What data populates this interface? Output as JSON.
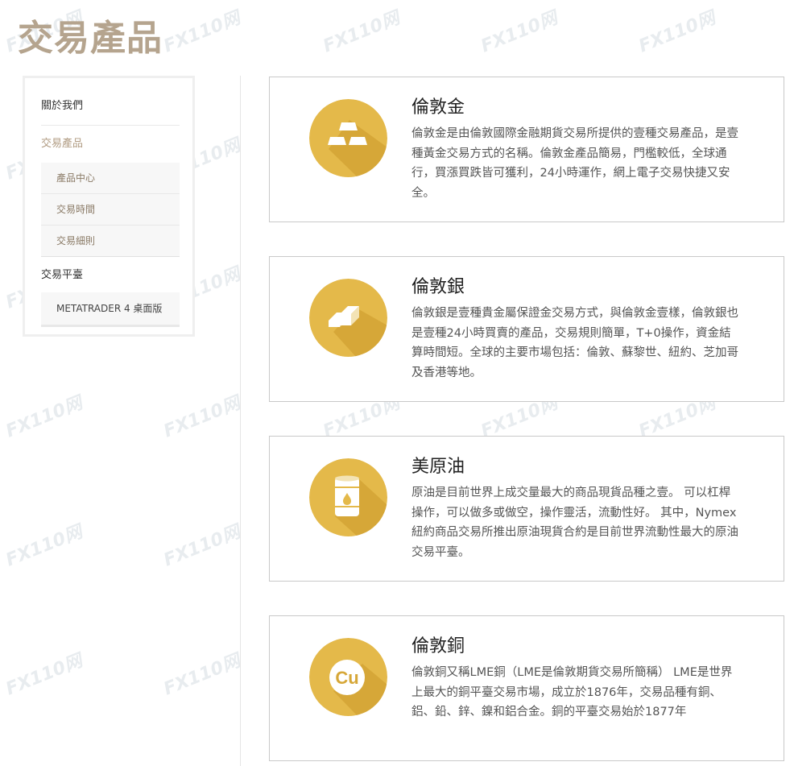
{
  "page": {
    "title": "交易產品",
    "title_color": "#b5a48e"
  },
  "sidebar": {
    "about": "關於我們",
    "products": {
      "label": "交易產品",
      "color": "#b09b82",
      "items": [
        "產品中心",
        "交易時間",
        "交易細則"
      ]
    },
    "platform": {
      "label": "交易平臺",
      "items": [
        "METATRADER 4 桌面版"
      ]
    }
  },
  "products": [
    {
      "name": "倫敦金",
      "icon": "gold-bars-icon",
      "desc": "倫敦金是由倫敦國際金融期貨交易所提供的壹種交易產品，是壹種黃金交易方式的名稱。倫敦金產品簡易，門檻較低，全球通行，買漲買跌皆可獲利，24小時運作，網上電子交易快捷又安全。"
    },
    {
      "name": "倫敦銀",
      "icon": "silver-bars-icon",
      "desc": "倫敦銀是壹種貴金屬保證金交易方式，與倫敦金壹樣，倫敦銀也是壹種24小時買賣的產品，交易規則簡單，T+0操作，資金結算時間短。全球的主要市場包括：倫敦、蘇黎世、紐約、芝加哥及香港等地。"
    },
    {
      "name": "美原油",
      "icon": "oil-barrel-icon",
      "desc": "原油是目前世界上成交量最大的商品現貨品種之壹。 可以杠桿操作，可以做多或做空，操作靈活，流動性好。 其中，Nymex紐約商品交易所推出原油現貨合約是目前世界流動性最大的原油交易平臺。"
    },
    {
      "name": "倫敦銅",
      "icon": "copper-cu-icon",
      "icon_text": "Cu",
      "desc": "倫敦銅又稱LME銅（LME是倫敦期貨交易所簡稱） LME是世界上最大的銅平臺交易市場，成立於1876年，交易品種有銅、鋁、鉛、鋅、鎳和鋁合金。銅的平臺交易始於1877年"
    }
  ],
  "colors": {
    "icon_circle": "#e4b94a",
    "icon_shadow": "#d6a738",
    "card_border": "#c9c9c9"
  },
  "watermark": "FX110网"
}
